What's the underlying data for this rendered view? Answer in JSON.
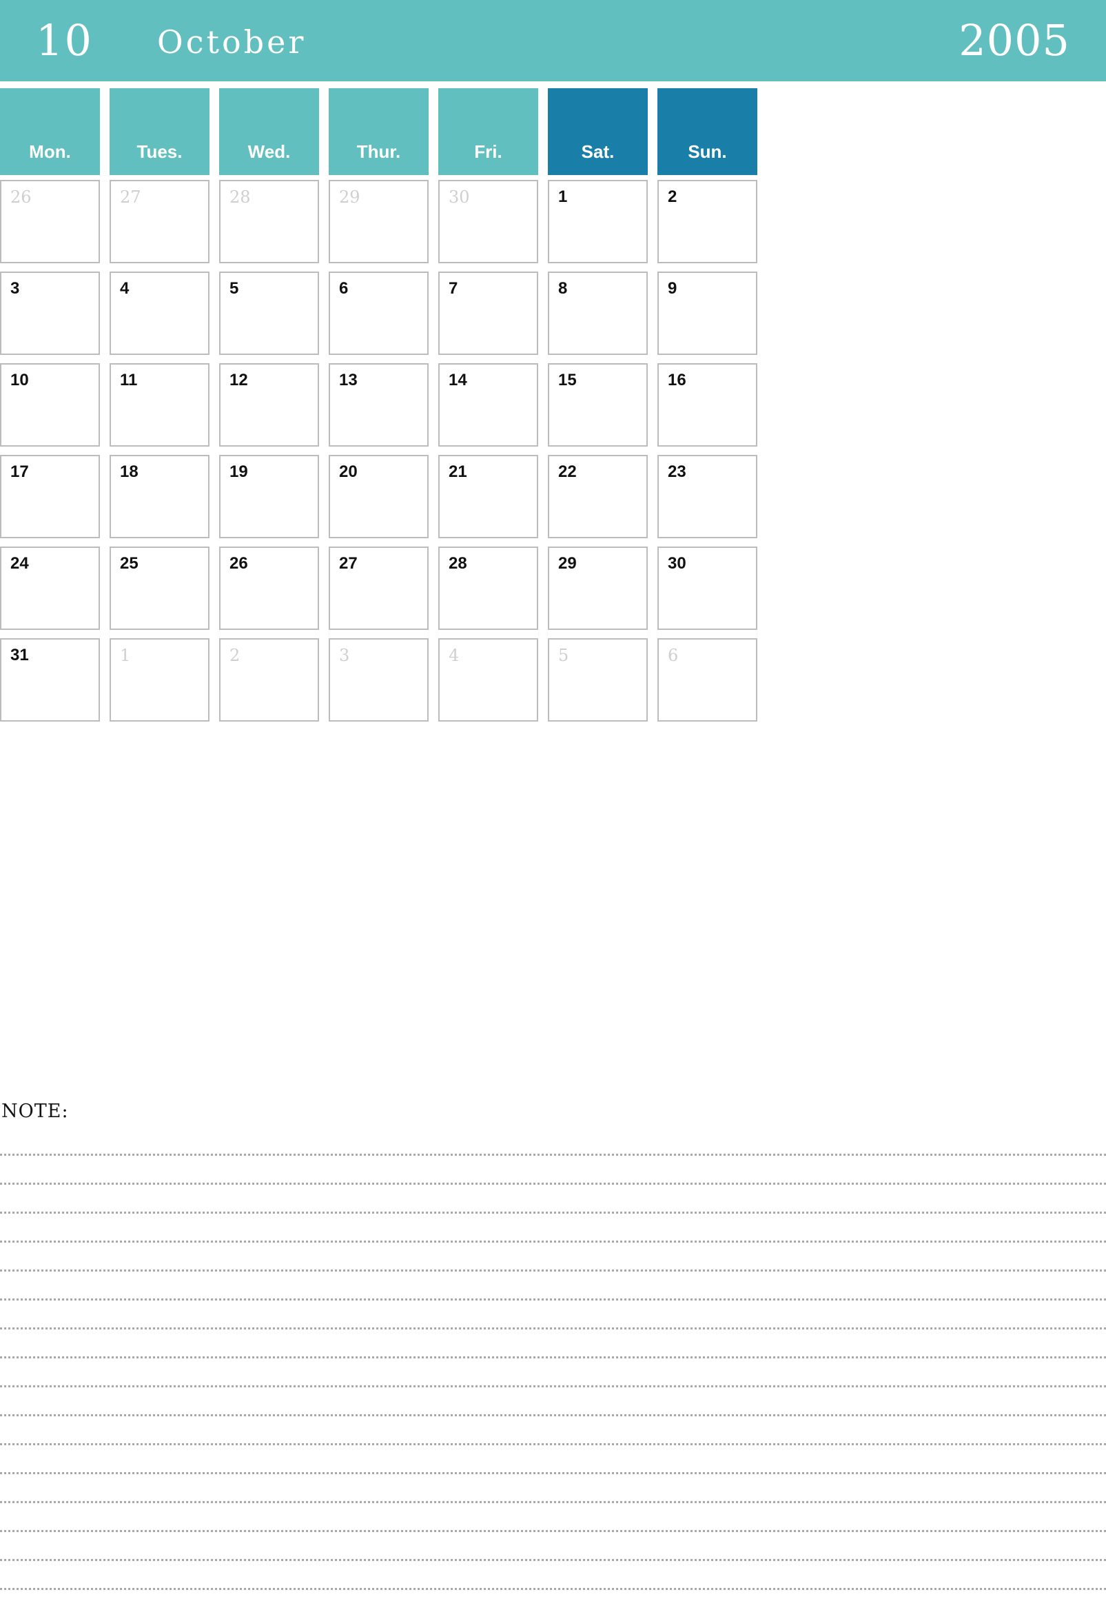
{
  "header": {
    "month_number": "10",
    "month_name": "October",
    "year": "2005"
  },
  "colors": {
    "weekday_teal": "#62bfbf",
    "weekend_blue": "#1a7fa8",
    "cell_border": "#bcbcbc",
    "other_month_text": "#cfcfcf",
    "current_month_text": "#111111",
    "header_text": "#ffffff",
    "note_line": "#a8a8a8"
  },
  "weekdays": [
    {
      "label": "Mon.",
      "weekend": false
    },
    {
      "label": "Tues.",
      "weekend": false
    },
    {
      "label": "Wed.",
      "weekend": false
    },
    {
      "label": "Thur.",
      "weekend": false
    },
    {
      "label": "Fri.",
      "weekend": false
    },
    {
      "label": "Sat.",
      "weekend": true
    },
    {
      "label": "Sun.",
      "weekend": true
    }
  ],
  "weeks": [
    [
      {
        "day": "26",
        "current": false
      },
      {
        "day": "27",
        "current": false
      },
      {
        "day": "28",
        "current": false
      },
      {
        "day": "29",
        "current": false
      },
      {
        "day": "30",
        "current": false
      },
      {
        "day": "1",
        "current": true
      },
      {
        "day": "2",
        "current": true
      }
    ],
    [
      {
        "day": "3",
        "current": true
      },
      {
        "day": "4",
        "current": true
      },
      {
        "day": "5",
        "current": true
      },
      {
        "day": "6",
        "current": true
      },
      {
        "day": "7",
        "current": true
      },
      {
        "day": "8",
        "current": true
      },
      {
        "day": "9",
        "current": true
      }
    ],
    [
      {
        "day": "10",
        "current": true
      },
      {
        "day": "11",
        "current": true
      },
      {
        "day": "12",
        "current": true
      },
      {
        "day": "13",
        "current": true
      },
      {
        "day": "14",
        "current": true
      },
      {
        "day": "15",
        "current": true
      },
      {
        "day": "16",
        "current": true
      }
    ],
    [
      {
        "day": "17",
        "current": true
      },
      {
        "day": "18",
        "current": true
      },
      {
        "day": "19",
        "current": true
      },
      {
        "day": "20",
        "current": true
      },
      {
        "day": "21",
        "current": true
      },
      {
        "day": "22",
        "current": true
      },
      {
        "day": "23",
        "current": true
      }
    ],
    [
      {
        "day": "24",
        "current": true
      },
      {
        "day": "25",
        "current": true
      },
      {
        "day": "26",
        "current": true
      },
      {
        "day": "27",
        "current": true
      },
      {
        "day": "28",
        "current": true
      },
      {
        "day": "29",
        "current": true
      },
      {
        "day": "30",
        "current": true
      }
    ],
    [
      {
        "day": "31",
        "current": true
      },
      {
        "day": "1",
        "current": false
      },
      {
        "day": "2",
        "current": false
      },
      {
        "day": "3",
        "current": false
      },
      {
        "day": "4",
        "current": false
      },
      {
        "day": "5",
        "current": false
      },
      {
        "day": "6",
        "current": false
      }
    ]
  ],
  "note": {
    "title": "NOTE:",
    "line_count": 16
  }
}
